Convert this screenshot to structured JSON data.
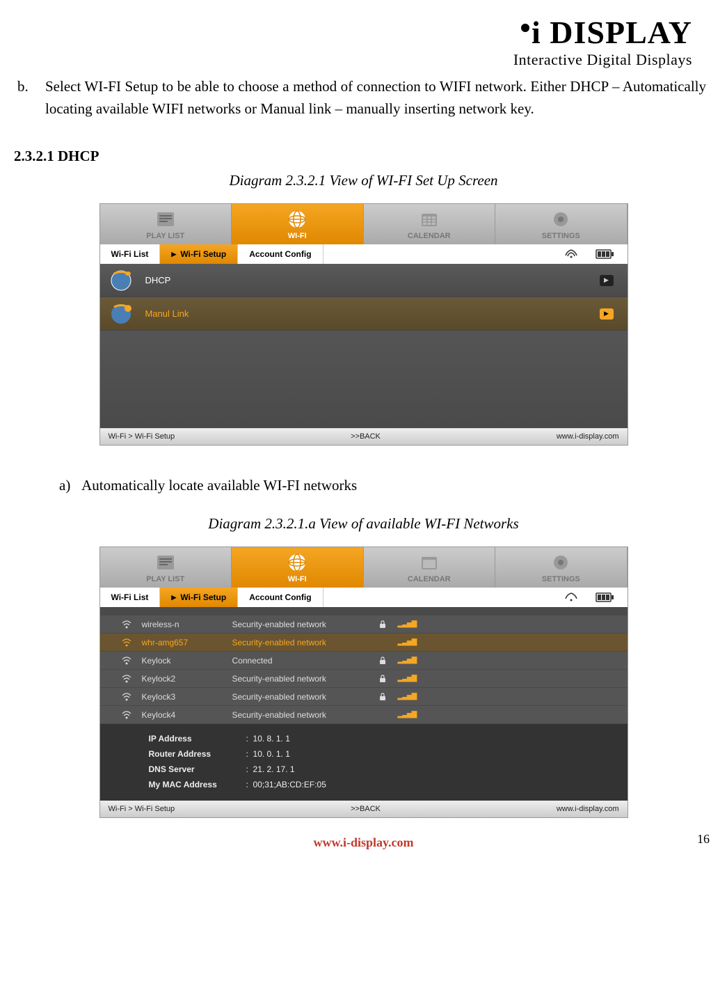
{
  "logo": {
    "main": "i DISPLAY",
    "sub": "Interactive Digital Displays"
  },
  "intro": {
    "marker": "b.",
    "text": "Select WI-FI Setup to be able to choose a method of connection to WIFI network. Either DHCP – Automatically locating available WIFI networks or Manual link – manually inserting network key."
  },
  "section1": {
    "heading": "2.3.2.1 DHCP",
    "caption": "Diagram 2.3.2.1      View of WI-FI Set Up Screen"
  },
  "screenshot1": {
    "top_tabs": [
      "PLAY LIST",
      "WI-FI",
      "CALENDAR",
      "SETTINGS"
    ],
    "sub_tabs": [
      "Wi-Fi List",
      "Wi-Fi Setup",
      "Account Config"
    ],
    "menu": [
      {
        "label": "DHCP",
        "selected": false
      },
      {
        "label": "Manul Link",
        "selected": true
      }
    ],
    "footer": {
      "left": "Wi-Fi > Wi-Fi Setup",
      "mid": ">>BACK",
      "right": "www.i-display.com"
    }
  },
  "sub_a": {
    "marker": "a)",
    "text": "Automatically locate available WI-FI networks"
  },
  "section2": {
    "caption": "Diagram 2.3.2.1.a    View of available WI-FI Networks"
  },
  "screenshot2": {
    "top_tabs": [
      "PLAY LIST",
      "WI-FI",
      "CALENDAR",
      "SETTINGS"
    ],
    "sub_tabs": [
      "Wi-Fi List",
      "Wi-Fi Setup",
      "Account Config"
    ],
    "networks": [
      {
        "ssid": "wireless-n",
        "status": "Security-enabled network",
        "lock": true,
        "selected": false
      },
      {
        "ssid": "whr-amg657",
        "status": "Security-enabled network",
        "lock": false,
        "selected": true
      },
      {
        "ssid": "Keylock",
        "status": "Connected",
        "lock": true,
        "selected": false
      },
      {
        "ssid": "Keylock2",
        "status": "Security-enabled network",
        "lock": true,
        "selected": false
      },
      {
        "ssid": "Keylock3",
        "status": "Security-enabled network",
        "lock": true,
        "selected": false
      },
      {
        "ssid": "Keylock4",
        "status": "Security-enabled network",
        "lock": false,
        "selected": false
      }
    ],
    "info": [
      {
        "label": "IP Address",
        "value": "10. 8. 1. 1"
      },
      {
        "label": "Router Address",
        "value": "10. 0. 1. 1"
      },
      {
        "label": "DNS Server",
        "value": "21. 2. 17. 1"
      },
      {
        "label": "My MAC Address",
        "value": "00;31;AB:CD:EF:05"
      }
    ],
    "footer": {
      "left": "Wi-Fi > Wi-Fi Setup",
      "mid": ">>BACK",
      "right": "www.i-display.com"
    }
  },
  "page_number": "16",
  "footer_link": "www.i-display.com"
}
